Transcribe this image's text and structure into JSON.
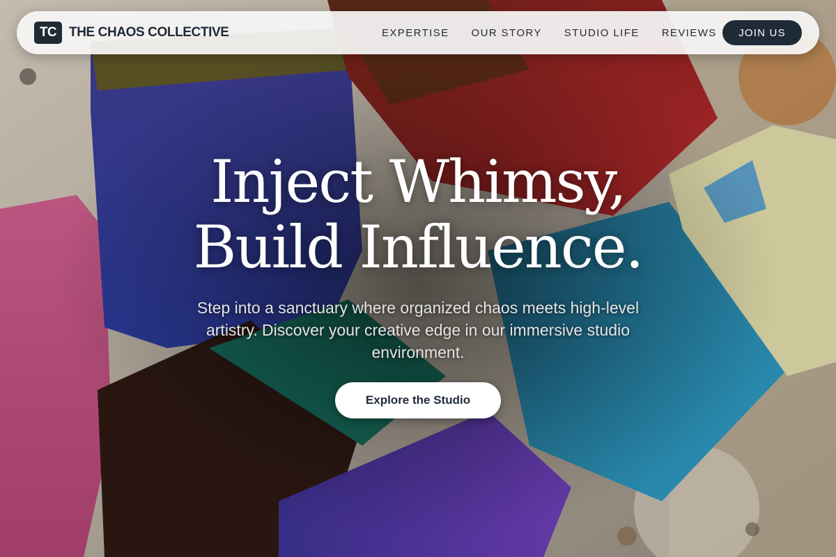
{
  "brand": {
    "mark": "TC",
    "name": "THE CHAOS COLLECTIVE"
  },
  "nav": {
    "links": [
      "EXPERTISE",
      "OUR STORY",
      "STUDIO LIFE",
      "REVIEWS"
    ],
    "cta_label": "JOIN US"
  },
  "hero": {
    "headline_line1": "Inject Whimsy,",
    "headline_line2": "Build Influence.",
    "subtitle": "Step into a sanctuary where organized chaos meets high-level artistry. Discover your creative edge in our immersive studio environment.",
    "button_label": "Explore the Studio",
    "background_image": "paint-brushes-photo"
  },
  "colors": {
    "primary_dark": "#1f2a37",
    "nav_background": "#f6f6f6",
    "button_light": "#ffffff"
  }
}
